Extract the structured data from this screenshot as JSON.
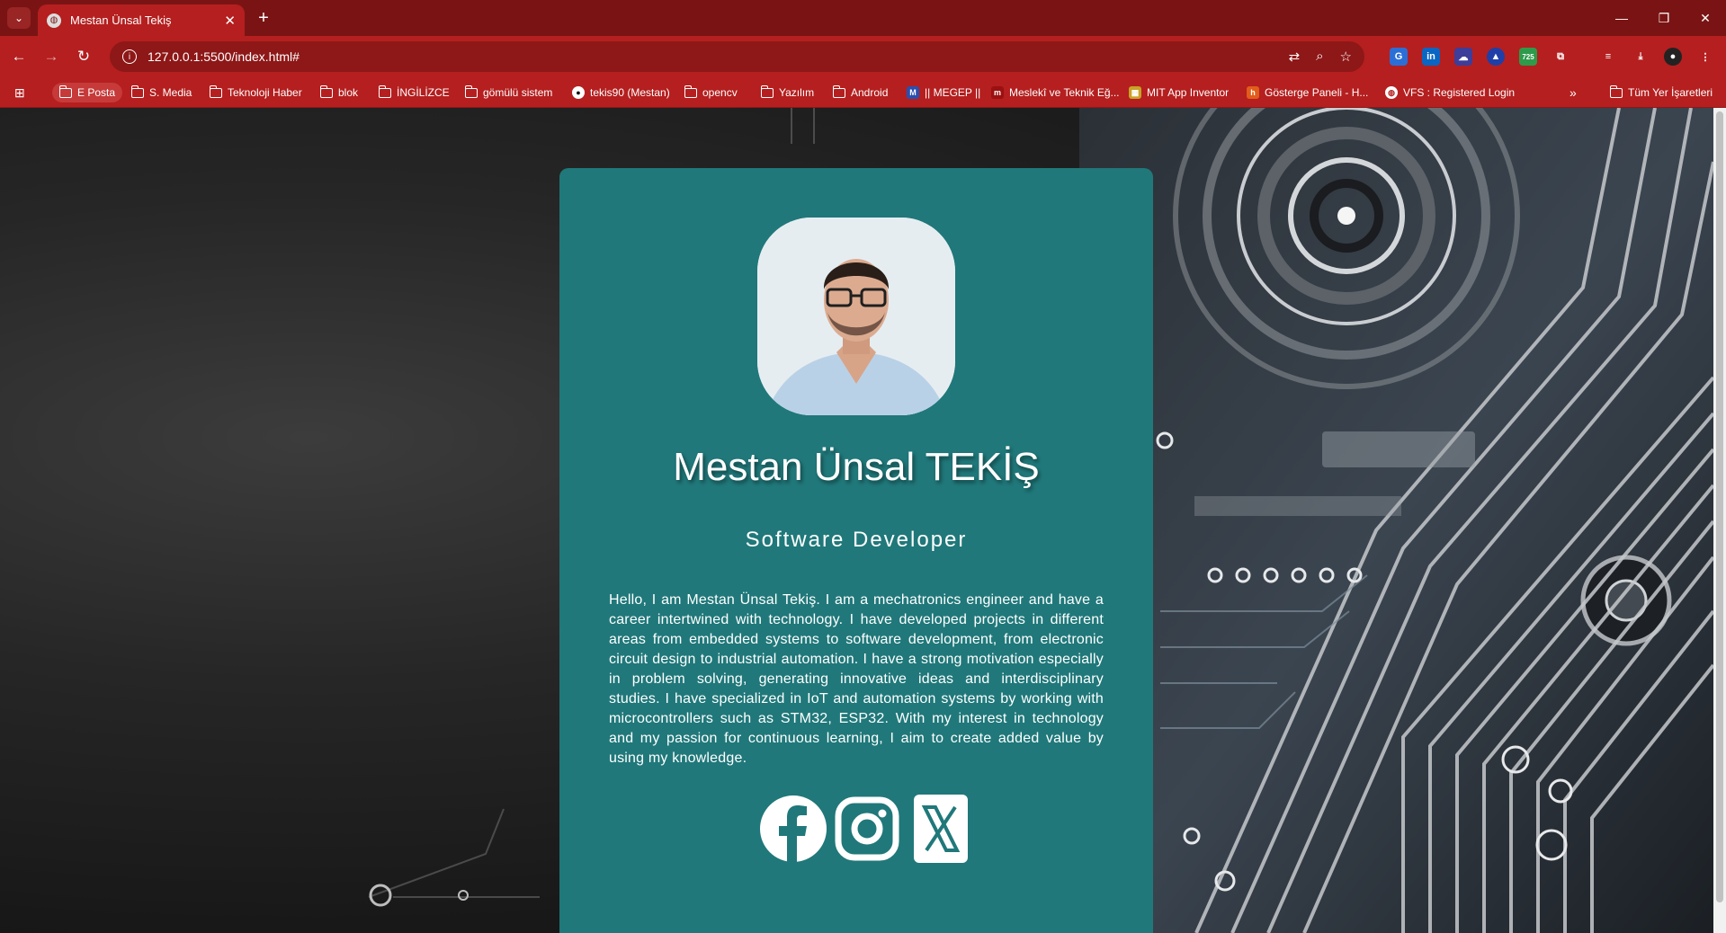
{
  "browser": {
    "tab_title": "Mestan Ünsal Tekiş",
    "url": "127.0.0.1:5500/index.html#",
    "extension_badge": "725",
    "bookmarks": [
      {
        "label": "E Posta",
        "icon": "folder-icon"
      },
      {
        "label": "S. Media",
        "icon": "folder-icon"
      },
      {
        "label": "Teknoloji Haber",
        "icon": "folder-icon"
      },
      {
        "label": "blok",
        "icon": "folder-icon"
      },
      {
        "label": "İNGİLİZCE",
        "icon": "folder-icon"
      },
      {
        "label": "gömülü sistem",
        "icon": "folder-icon"
      },
      {
        "label": "tekis90 (Mestan)",
        "icon": "github-icon"
      },
      {
        "label": "opencv",
        "icon": "folder-icon"
      },
      {
        "label": "Yazılım",
        "icon": "folder-icon"
      },
      {
        "label": "Android",
        "icon": "folder-icon"
      },
      {
        "label": "|| MEGEP ||",
        "icon": "megep-icon"
      },
      {
        "label": "Meslekî ve Teknik Eğ...",
        "icon": "meb-icon"
      },
      {
        "label": "MIT App Inventor",
        "icon": "mit-icon"
      },
      {
        "label": "Gösterge Paneli - H...",
        "icon": "dashboard-icon"
      },
      {
        "label": "VFS : Registered Login",
        "icon": "globe-icon"
      }
    ],
    "all_bookmarks_label": "Tüm Yer İşaretleri"
  },
  "profile": {
    "name": "Mestan Ünsal TEKİŞ",
    "role": "Software Developer",
    "bio": "Hello, I am Mestan Ünsal Tekiş. I am a mechatronics engineer and have a career intertwined with technology. I have developed projects in different areas from embedded systems to software development, from electronic circuit design to industrial automation. I have a strong motivation especially in problem solving, generating innovative ideas and interdisciplinary studies. I have specialized in IoT and automation systems by working with microcontrollers such as STM32, ESP32. With my interest in technology and my passion for continuous learning, I aim to create added value by using my knowledge.",
    "socials": [
      "facebook-icon",
      "instagram-icon",
      "x-icon"
    ]
  },
  "colors": {
    "chrome_dark": "#7a1414",
    "chrome": "#b51f1f",
    "card": "#20787a"
  }
}
